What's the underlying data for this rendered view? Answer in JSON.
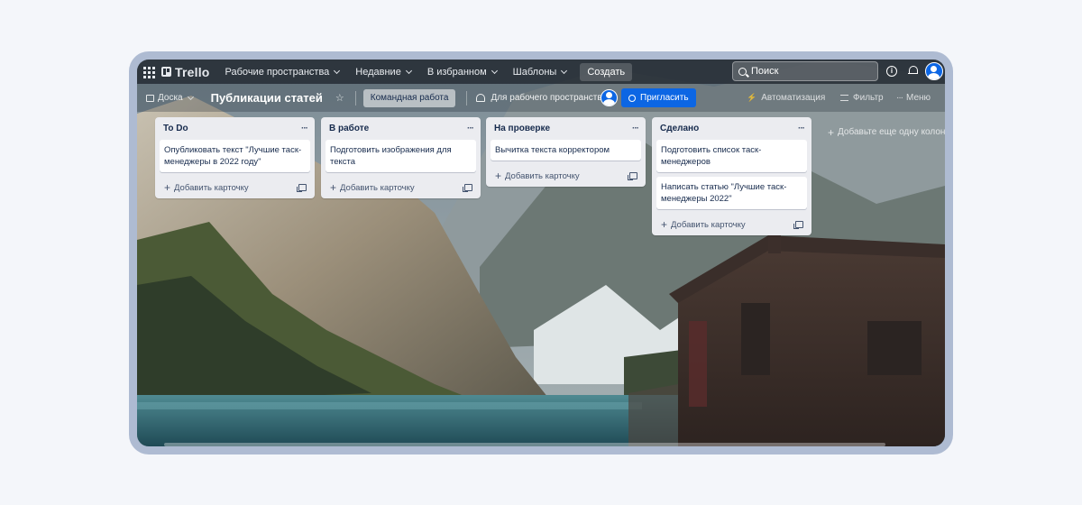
{
  "topnav": {
    "logo": "Trello",
    "items": [
      {
        "label": "Рабочие пространства"
      },
      {
        "label": "Недавние"
      },
      {
        "label": "В избранном"
      },
      {
        "label": "Шаблоны"
      }
    ],
    "create": "Создать",
    "search_placeholder": "Поиск"
  },
  "boardbar": {
    "view": "Доска",
    "title": "Публикации статей",
    "team": "Командная работа",
    "workspace_visibility": "Для рабочего пространства",
    "invite": "Пригласить",
    "automation": "Автоматизация",
    "filter": "Фильтр",
    "menu": "Меню"
  },
  "lists": [
    {
      "title": "To Do",
      "cards": [
        "Опубликовать текст \"Лучшие таск-менеджеры в 2022 году\""
      ],
      "add_card": "Добавить карточку"
    },
    {
      "title": "В работе",
      "cards": [
        "Подготовить изображения для текста"
      ],
      "add_card": "Добавить карточку"
    },
    {
      "title": "На проверке",
      "cards": [
        "Вычитка текста корректором"
      ],
      "add_card": "Добавить карточку"
    },
    {
      "title": "Сделано",
      "cards": [
        "Подготовить список таск-менеджеров",
        "Написать статью \"Лучшие таск-менеджеры 2022\""
      ],
      "add_card": "Добавить карточку"
    }
  ],
  "add_list": "Добавьте еще одну колонку",
  "colors": {
    "accent": "#0c66e4",
    "list_bg": "#ebecf0",
    "frame": "#aebbd2"
  }
}
